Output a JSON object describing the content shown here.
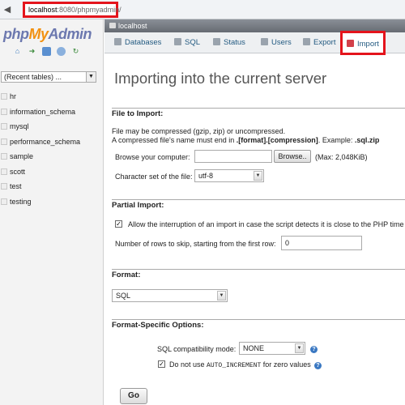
{
  "browser": {
    "url_host": "localhost",
    "url_rest": ":8080/phpmyadmin/"
  },
  "sidebar": {
    "logo": {
      "php": "php",
      "my": "My",
      "admin": "Admin"
    },
    "icons": [
      "home-icon",
      "logout-icon",
      "query-window-icon",
      "docs-icon",
      "reload-icon"
    ],
    "recent_tables": "(Recent tables) ...",
    "databases": [
      "hr",
      "information_schema",
      "mysql",
      "performance_schema",
      "sample",
      "scott",
      "test",
      "testing"
    ]
  },
  "server_bar": {
    "label": "localhost"
  },
  "tabs": [
    {
      "label": "Databases",
      "icon": "database-icon"
    },
    {
      "label": "SQL",
      "icon": "sql-icon"
    },
    {
      "label": "Status",
      "icon": "status-icon"
    },
    {
      "label": "Users",
      "icon": "users-icon"
    },
    {
      "label": "Export",
      "icon": "export-icon"
    },
    {
      "label": "Import",
      "icon": "import-icon",
      "active": true
    }
  ],
  "main": {
    "title": "Importing into the current server",
    "file_to_import": {
      "legend": "File to Import:",
      "note1": "File may be compressed (gzip, zip) or uncompressed.",
      "note2_pre": "A compressed file's name must end in ",
      "note2_bold": ".[format].[compression]",
      "note2_mid": ". Example: ",
      "note2_example": ".sql.zip",
      "browse_label": "Browse your computer:",
      "file_value": "",
      "browse_button": "Browse..",
      "max_size": "(Max: 2,048KiB)",
      "charset_label": "Character set of the file:",
      "charset_value": "utf-8"
    },
    "partial_import": {
      "legend": "Partial Import:",
      "allow_interrupt_label": "Allow the interruption of an import in case the script detects it is close to the PHP time",
      "allow_interrupt_checked": true,
      "skip_rows_label": "Number of rows to skip, starting from the first row:",
      "skip_rows_value": "0"
    },
    "format": {
      "legend": "Format:",
      "value": "SQL"
    },
    "format_options": {
      "legend": "Format-Specific Options:",
      "compat_label": "SQL compatibility mode:",
      "compat_value": "NONE",
      "auto_inc_pre": "Do not use ",
      "auto_inc_code": "AUTO_INCREMENT",
      "auto_inc_post": " for zero values",
      "auto_inc_checked": true
    },
    "go_button": "Go"
  }
}
